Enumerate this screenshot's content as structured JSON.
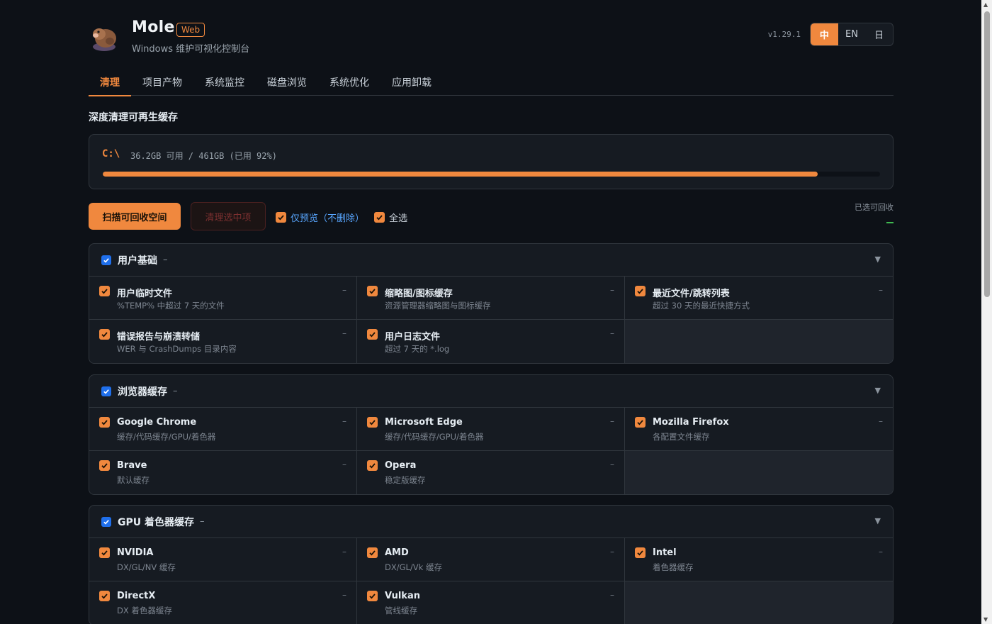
{
  "app": {
    "name": "Mole",
    "badge": "Web",
    "subtitle": "Windows 维护可视化控制台",
    "version": "v1.29.1"
  },
  "lang": {
    "options": [
      "中",
      "EN",
      "日"
    ],
    "active": "中"
  },
  "tabs": [
    {
      "label": "清理",
      "active": true
    },
    {
      "label": "项目产物"
    },
    {
      "label": "系统监控"
    },
    {
      "label": "磁盘浏览"
    },
    {
      "label": "系统优化"
    },
    {
      "label": "应用卸载"
    }
  ],
  "section_title": "深度清理可再生缓存",
  "disk": {
    "drive": "C:\\",
    "info": "36.2GB 可用 / 461GB (已用 92%)",
    "used_percent": 92
  },
  "actions": {
    "scan_label": "扫描可回收空间",
    "clean_label": "清理选中项",
    "preview_label": "仅预览（不删除）",
    "selectall_label": "全选",
    "reclaim_label": "已选可回收"
  },
  "groups": [
    {
      "title": "用户基础",
      "dash": "–",
      "items": [
        {
          "name": "用户临时文件",
          "desc": "%TEMP% 中超过 7 天的文件",
          "dash": "–"
        },
        {
          "name": "缩略图/图标缓存",
          "desc": "资源管理器缩略图与图标缓存",
          "dash": "–"
        },
        {
          "name": "最近文件/跳转列表",
          "desc": "超过 30 天的最近快捷方式",
          "dash": "–"
        },
        {
          "name": "错误报告与崩溃转储",
          "desc": "WER 与 CrashDumps 目录内容",
          "dash": "–"
        },
        {
          "name": "用户日志文件",
          "desc": "超过 7 天的 *.log",
          "dash": "–"
        }
      ]
    },
    {
      "title": "浏览器缓存",
      "dash": "–",
      "items": [
        {
          "name": "Google Chrome",
          "desc": "缓存/代码缓存/GPU/着色器",
          "dash": "–"
        },
        {
          "name": "Microsoft Edge",
          "desc": "缓存/代码缓存/GPU/着色器",
          "dash": "–"
        },
        {
          "name": "Mozilla Firefox",
          "desc": "各配置文件缓存",
          "dash": "–"
        },
        {
          "name": "Brave",
          "desc": "默认缓存",
          "dash": "–"
        },
        {
          "name": "Opera",
          "desc": "稳定版缓存",
          "dash": "–"
        }
      ]
    },
    {
      "title": "GPU 着色器缓存",
      "dash": "–",
      "items": [
        {
          "name": "NVIDIA",
          "desc": "DX/GL/NV 缓存",
          "dash": "–"
        },
        {
          "name": "AMD",
          "desc": "DX/GL/Vk 缓存",
          "dash": "–"
        },
        {
          "name": "Intel",
          "desc": "着色器缓存",
          "dash": "–"
        },
        {
          "name": "DirectX",
          "desc": "DX 着色器缓存",
          "dash": "–"
        },
        {
          "name": "Vulkan",
          "desc": "管线缓存",
          "dash": "–"
        }
      ]
    }
  ]
}
